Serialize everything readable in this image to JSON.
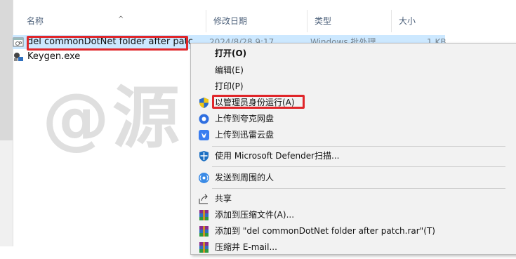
{
  "columns": {
    "name": "名称",
    "date": "修改日期",
    "type": "类型",
    "size": "大小",
    "sort_arrow": "^"
  },
  "files": [
    {
      "name": "del commonDotNet folder after patc",
      "date": "2024/8/28 9:17",
      "type": "Windows 批处理",
      "size": "1 KB",
      "icon": "batch-file-icon"
    },
    {
      "name": "Keygen.exe",
      "icon": "exe-file-icon"
    }
  ],
  "watermark": "@源 二 风",
  "context_menu": {
    "open": "打开(O)",
    "edit": "编辑(E)",
    "print": "打印(P)",
    "run_as_admin": "以管理员身份运行(A)",
    "upload_quark": "上传到夸克网盘",
    "upload_xunlei": "上传到迅雷云盘",
    "defender": "使用 Microsoft Defender扫描...",
    "send_nearby": "发送到周围的人",
    "share": "共享",
    "add_archive": "添加到压缩文件(A)...",
    "add_rar": "添加到 \"del commonDotNet folder after patch.rar\"(T)",
    "compress_email": "压缩并 E-mail..."
  },
  "colors": {
    "highlight_box": "#e0262a",
    "selected_row": "#cce8ff",
    "menu_bg": "#f2f2f2"
  }
}
